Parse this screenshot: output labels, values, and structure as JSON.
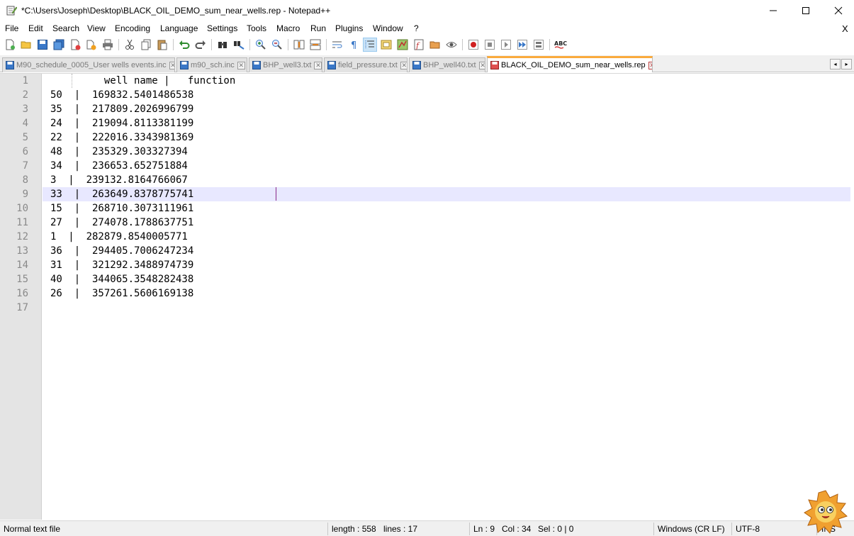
{
  "window": {
    "title": "*C:\\Users\\Joseph\\Desktop\\BLACK_OIL_DEMO_sum_near_wells.rep - Notepad++"
  },
  "menu": {
    "items": [
      "File",
      "Edit",
      "Search",
      "View",
      "Encoding",
      "Language",
      "Settings",
      "Tools",
      "Macro",
      "Run",
      "Plugins",
      "Window",
      "?"
    ],
    "close_label": "X"
  },
  "toolbar": {
    "buttons": [
      "new-file",
      "open-file",
      "save",
      "save-all",
      "close",
      "close-all",
      "print",
      "cut",
      "copy",
      "paste",
      "undo",
      "redo",
      "find",
      "replace",
      "zoom-in",
      "zoom-out",
      "sync-vertical",
      "sync-horizontal",
      "word-wrap",
      "show-all-characters",
      "indent-guide",
      "user-defined-language",
      "document-map",
      "function-list",
      "folder-as-workspace",
      "monitoring",
      "record-macro",
      "stop-recording",
      "playback-macro",
      "run-macro-multiple",
      "save-macro",
      "spell-check"
    ],
    "spell_label": "ABC"
  },
  "tabs": [
    {
      "label": "M90_schedule_0005_User wells events.inc",
      "active": false,
      "modified": false
    },
    {
      "label": "m90_sch.inc",
      "active": false,
      "modified": false
    },
    {
      "label": "BHP_well3.txt",
      "active": false,
      "modified": false
    },
    {
      "label": "field_pressure.txt",
      "active": false,
      "modified": false
    },
    {
      "label": "BHP_well40.txt",
      "active": false,
      "modified": false
    },
    {
      "label": "BLACK_OIL_DEMO_sum_near_wells.rep",
      "active": true,
      "modified": true
    }
  ],
  "tab_scroll": {
    "left": "◂",
    "right": "▸"
  },
  "editor": {
    "lines": [
      "         well name |   function",
      "50  |  169832.5401486538",
      "35  |  217809.2026996799",
      "24  |  219094.8113381199",
      "22  |  222016.3343981369",
      "48  |  235329.303327394",
      "34  |  236653.652751884",
      "3  |  239132.8164766067",
      "33  |  263649.8378775741",
      "15  |  268710.3073111961",
      "27  |  274078.1788637751",
      "1  |  282879.8540005771",
      "36  |  294405.7006247234",
      "31  |  321292.3488974739",
      "40  |  344065.3548282438",
      "26  |  357261.5606169138",
      ""
    ],
    "current_line": 9
  },
  "status": {
    "file_type": "Normal text file",
    "length": "length : 558",
    "lines": "lines : 17",
    "ln": "Ln : 9",
    "col": "Col : 34",
    "sel": "Sel : 0 | 0",
    "eol": "Windows (CR LF)",
    "encoding": "UTF-8",
    "mode": "INS"
  },
  "colors": {
    "active_tab_accent": "#faaa3c",
    "current_line_bg": "#e8e8ff",
    "gutter_bg": "#e4e4e4",
    "caret": "#8a2a8a"
  }
}
